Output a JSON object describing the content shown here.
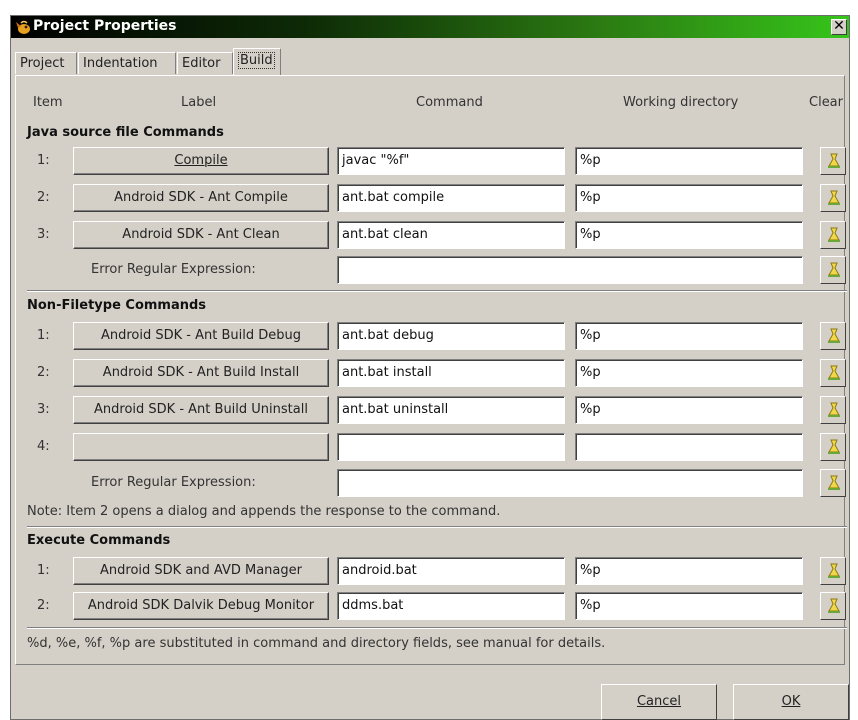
{
  "window": {
    "title": "Project Properties",
    "close_glyph": "✕"
  },
  "tabs": [
    {
      "label": "Project"
    },
    {
      "label": "Indentation"
    },
    {
      "label": "Editor"
    },
    {
      "label": "Build",
      "active": true
    }
  ],
  "headers": {
    "item": "Item",
    "label": "Label",
    "command": "Command",
    "working_directory": "Working directory",
    "clear": "Clear"
  },
  "java_section": {
    "title": "Java source file Commands",
    "rows": [
      {
        "num": "1:",
        "label": "Compile",
        "command": "javac \"%f\"",
        "dir": "%p"
      },
      {
        "num": "2:",
        "label": "Android SDK - Ant Compile",
        "command": "ant.bat compile",
        "dir": "%p"
      },
      {
        "num": "3:",
        "label": "Android SDK - Ant Clean",
        "command": "ant.bat clean",
        "dir": "%p"
      }
    ],
    "error_label": "Error Regular Expression:",
    "error_value": ""
  },
  "nonfiletype_section": {
    "title": "Non-Filetype Commands",
    "rows": [
      {
        "num": "1:",
        "label": "Android SDK - Ant Build Debug",
        "command": "ant.bat debug",
        "dir": "%p"
      },
      {
        "num": "2:",
        "label": "Android SDK - Ant Build Install",
        "command": "ant.bat install",
        "dir": "%p"
      },
      {
        "num": "3:",
        "label": "Android SDK - Ant Build Uninstall",
        "command": "ant.bat uninstall",
        "dir": "%p"
      },
      {
        "num": "4:",
        "label": "",
        "command": "",
        "dir": ""
      }
    ],
    "error_label": "Error Regular Expression:",
    "error_value": "",
    "note": "Note: Item 2 opens a dialog and appends the response to the command."
  },
  "execute_section": {
    "title": "Execute Commands",
    "rows": [
      {
        "num": "1:",
        "label": "Android SDK and AVD Manager",
        "command": "android.bat",
        "dir": "%p"
      },
      {
        "num": "2:",
        "label": "Android SDK Dalvik Debug Monitor",
        "command": "ddms.bat",
        "dir": "%p"
      }
    ]
  },
  "footer_note": "%d, %e, %f, %p are substituted in command and directory fields, see manual for details.",
  "buttons": {
    "cancel": "Cancel",
    "ok": "OK"
  },
  "icons": {
    "window": "app-icon",
    "clear": "clear-icon"
  }
}
